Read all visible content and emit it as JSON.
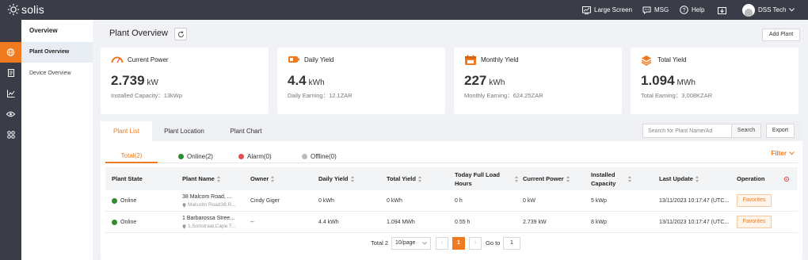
{
  "topbar": {
    "logo_text": "solis",
    "large_screen_label": "Large Screen",
    "msg_label": "MSG",
    "help_label": "Help",
    "user_name": "DSS Tech"
  },
  "sidebar": {
    "header": "Overview",
    "items": [
      {
        "label": "Plant Overview",
        "active": true
      },
      {
        "label": "Device Overview",
        "active": false
      }
    ]
  },
  "page": {
    "title": "Plant Overview",
    "add_plant_label": "Add Plant"
  },
  "cards": [
    {
      "title": "Current Power",
      "value": "2.739",
      "unit": "kW",
      "sub": "Installed Capacity：13kWp"
    },
    {
      "title": "Daily Yield",
      "value": "4.4",
      "unit": "kWh",
      "sub": "Daily Earning：12.1ZAR"
    },
    {
      "title": "Monthly Yield",
      "value": "227",
      "unit": "kWh",
      "sub": "Monthly Earning：624.25ZAR"
    },
    {
      "title": "Total Yield",
      "value": "1.094",
      "unit": "MWh",
      "sub": "Total Earning：3,008KZAR"
    }
  ],
  "tabs": [
    {
      "label": "Plant List",
      "active": true
    },
    {
      "label": "Plant Location",
      "active": false
    },
    {
      "label": "Plant Chart",
      "active": false
    }
  ],
  "search": {
    "placeholder": "Search for Plant Name/Ad",
    "button_label": "Search",
    "export_label": "Export"
  },
  "status_tabs": [
    {
      "label": "Total(2)",
      "color": null,
      "active": true
    },
    {
      "label": "Online(2)",
      "color": "#2e8b2e",
      "active": false
    },
    {
      "label": "Alarm(0)",
      "color": "#e05050",
      "active": false
    },
    {
      "label": "Offline(0)",
      "color": "#bbbbbb",
      "active": false
    }
  ],
  "filter_label": "Filter",
  "table": {
    "columns": [
      "Plant State",
      "Plant Name",
      "Owner",
      "Daily Yield",
      "Total Yield",
      "Today Full Load Hours",
      "Current Power",
      "Installed Capacity",
      "Last Update",
      "Operation"
    ],
    "rows": [
      {
        "state": "Online",
        "name": "38 Malcom Road, ...",
        "address": "Malcolm Road38,R...",
        "owner": "Cindy Giger",
        "daily_yield": "0 kWh",
        "total_yield": "0 kWh",
        "full_load_hours": "0 h",
        "current_power": "0 kW",
        "installed_capacity": "5 kWp",
        "last_update": "13/11/2023 10:17:47 (UTC...",
        "operation": "Favorites"
      },
      {
        "state": "Online",
        "name": "1 Barbarossa Stree...",
        "address": "1,Sonstraal,Cape T...",
        "owner": "--",
        "daily_yield": "4.4 kWh",
        "total_yield": "1.094 MWh",
        "full_load_hours": "0.55 h",
        "current_power": "2.739 kW",
        "installed_capacity": "8 kWp",
        "last_update": "13/11/2023 10:17:47 (UTC...",
        "operation": "Favorites"
      }
    ]
  },
  "pagination": {
    "total": "Total 2",
    "page_size": "10/page",
    "current_page": "1",
    "goto_label": "Go to",
    "goto_value": "1"
  },
  "colors": {
    "accent": "#f07a1f",
    "topbar": "#3a3d48",
    "online": "#2e8b2e"
  }
}
